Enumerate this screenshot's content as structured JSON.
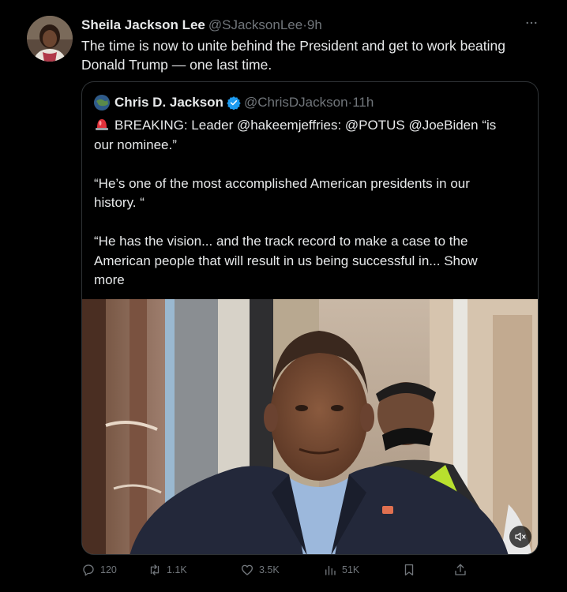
{
  "post": {
    "author_name": "Sheila Jackson Lee",
    "author_handle": "@SJacksonLee",
    "separator": "·",
    "time": "9h",
    "more_icon": "more-horizontal-icon",
    "text_line1": "The time is now to unite behind the President and get to work beating",
    "text_line2": "Donald Trump — one last time."
  },
  "quote": {
    "author_name": "Chris D. Jackson",
    "verified_color": "#1d9bf0",
    "author_handle": "@ChrisDJackson",
    "separator": "·",
    "time": "11h",
    "line1": "BREAKING:  Leader @hakeemjeffries: @POTUS @JoeBiden “is",
    "line2": "our nominee.”",
    "line3": "“He’s one of the most accomplished American presidents in our",
    "line4": "history. “",
    "line5": "“He has the vision... and the track record to make a case to the",
    "line6": "American people that will result in us being successful in...",
    "show_more_a": "Show",
    "show_more_b": "more"
  },
  "actions": {
    "reply_count": "120",
    "repost_count": "1.1K",
    "like_count": "3.5K",
    "views_count": "51K"
  }
}
